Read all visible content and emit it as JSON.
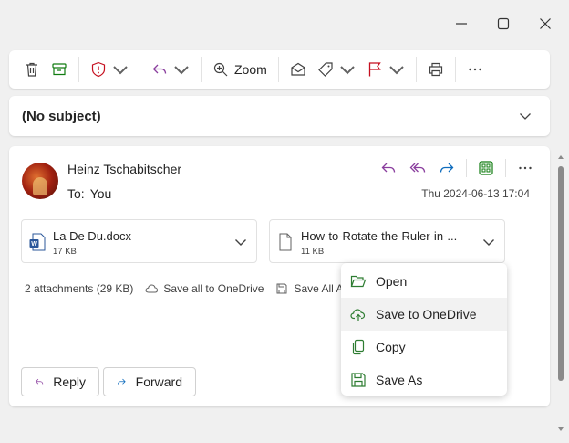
{
  "window": {
    "minimize_icon": "minimize-icon",
    "maximize_icon": "maximize-icon",
    "close_icon": "close-icon"
  },
  "toolbar": {
    "zoom_label": "Zoom",
    "icons": [
      "delete-icon",
      "archive-icon",
      "report-icon",
      "reply-icon",
      "zoom-icon",
      "mark-read-icon",
      "tag-icon",
      "flag-icon",
      "print-icon",
      "more-icon"
    ]
  },
  "subject": {
    "text": "(No subject)"
  },
  "message": {
    "sender": "Heinz Tschabitscher",
    "to_label": "To:",
    "to_value": "You",
    "date": "Thu 2024-06-13 17:04"
  },
  "attachments": [
    {
      "name": "La De Du.docx",
      "size": "17 KB",
      "type": "word-doc"
    },
    {
      "name": "How-to-Rotate-the-Ruler-in-...",
      "size": "11 KB",
      "type": "generic-file"
    }
  ],
  "attachment_meta": {
    "count": "2 attachments (29 KB)",
    "save_all_onedrive": "Save all to OneDrive",
    "save_all_attachments": "Save All At"
  },
  "buttons": {
    "reply": "Reply",
    "forward": "Forward"
  },
  "context_menu": {
    "items": [
      {
        "label": "Open",
        "icon": "folder-open-icon"
      },
      {
        "label": "Save to OneDrive",
        "icon": "cloud-upload-icon"
      },
      {
        "label": "Copy",
        "icon": "copy-icon"
      },
      {
        "label": "Save As",
        "icon": "save-icon"
      }
    ]
  },
  "colors": {
    "accent_purple": "#8a3e9e",
    "accent_blue": "#0f6cbd",
    "danger_red": "#c50f1f",
    "archive_green": "#107c10",
    "menu_icon_green": "#2e7d32"
  }
}
